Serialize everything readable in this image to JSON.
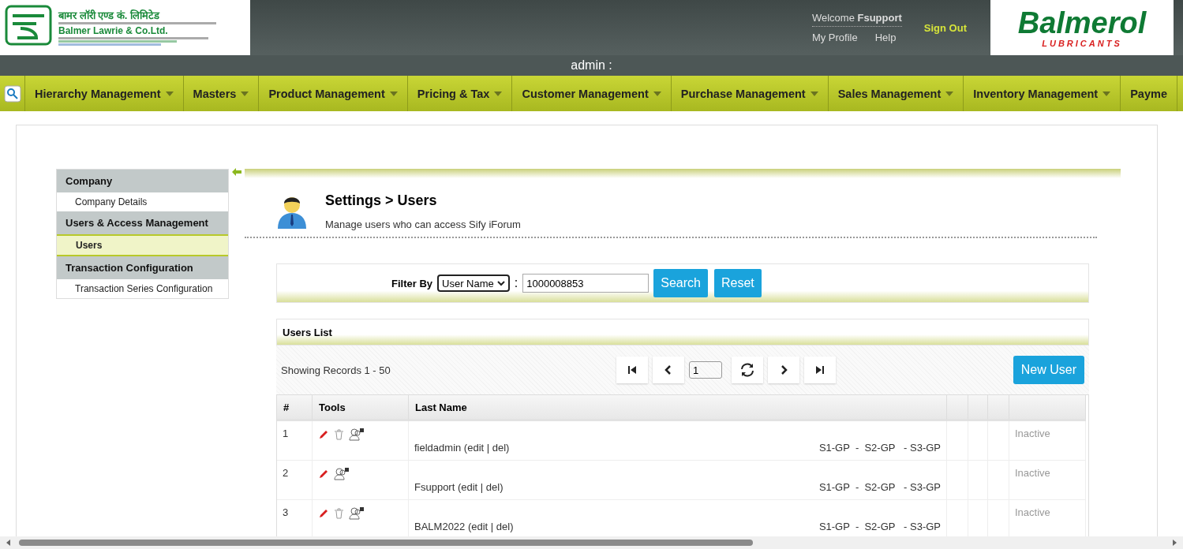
{
  "header": {
    "logo_left": {
      "hindi": "बामर लॉरी एण्ड कं. लिमिटेड",
      "name": "Balmer Lawrie & Co.Ltd."
    },
    "welcome": "Welcome",
    "user": "Fsupport",
    "links": [
      "My Profile",
      "Help"
    ],
    "sign_out": "Sign Out",
    "logo_right": {
      "brand": "Balmerol",
      "tagline": "LUBRICANTS"
    }
  },
  "role_bar": "admin :",
  "nav": [
    {
      "label": "Hierarchy Management",
      "dropdown": true
    },
    {
      "label": "Masters",
      "dropdown": true
    },
    {
      "label": "Product Management",
      "dropdown": true
    },
    {
      "label": "Pricing & Tax",
      "dropdown": true
    },
    {
      "label": "Customer Management",
      "dropdown": true
    },
    {
      "label": "Purchase Management",
      "dropdown": true
    },
    {
      "label": "Sales Management",
      "dropdown": true
    },
    {
      "label": "Inventory Management",
      "dropdown": true
    },
    {
      "label": "Payme",
      "dropdown": false
    }
  ],
  "sidebar": [
    {
      "heading": "Company",
      "items": [
        {
          "label": "Company Details",
          "selected": false
        }
      ]
    },
    {
      "heading": "Users & Access Management",
      "items": [
        {
          "label": "Users",
          "selected": true
        }
      ]
    },
    {
      "heading": "Transaction Configuration",
      "items": [
        {
          "label": "Transaction Series Configuration",
          "selected": false
        }
      ]
    }
  ],
  "page": {
    "title": "Settings > Users",
    "subtitle": "Manage users who can access Sify iForum"
  },
  "filter": {
    "label": "Filter By",
    "field": "User Name",
    "separator": ":",
    "value": "1000008853",
    "buttons": [
      "Search",
      "Reset"
    ]
  },
  "users_list": {
    "title": "Users List",
    "records": "Showing Records 1 - 50",
    "page": "1",
    "new_button": "New User"
  },
  "table": {
    "columns": [
      "#",
      "Tools",
      "Last Name"
    ],
    "rows": [
      {
        "number": "1",
        "deletable": true,
        "name": "fieldadmin (edit | del)",
        "groups": "S1-GP  -  S2-GP   - S3-GP",
        "status": "Inactive"
      },
      {
        "number": "2",
        "deletable": false,
        "name": "Fsupport (edit | del)",
        "groups": "S1-GP  -  S2-GP   - S3-GP",
        "status": "Inactive"
      },
      {
        "number": "3",
        "deletable": true,
        "name": "BALM2022 (edit | del)",
        "groups": "S1-GP  -  S2-GP   - S3-GP",
        "status": "Inactive"
      }
    ]
  }
}
